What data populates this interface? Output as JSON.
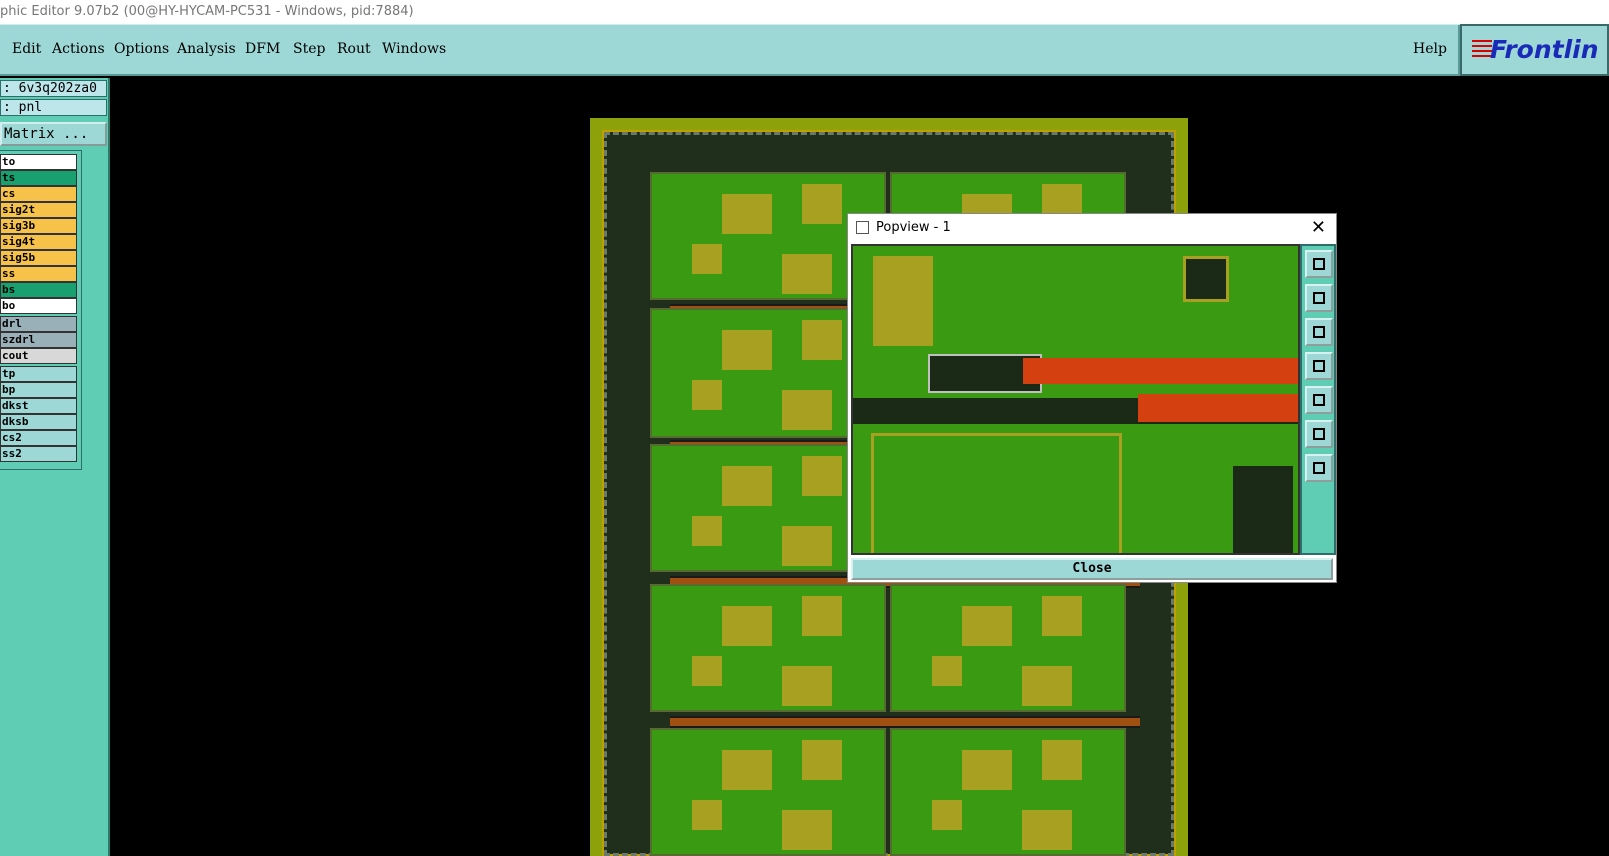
{
  "window": {
    "title": "phic Editor 9.07b2 (00@HY-HYCAM-PC531 - Windows, pid:7884)"
  },
  "menu": {
    "items": [
      {
        "label": "Edit"
      },
      {
        "label": "Actions"
      },
      {
        "label": "Options"
      },
      {
        "label": "Analysis"
      },
      {
        "label": "DFM"
      },
      {
        "label": "Step"
      },
      {
        "label": "Rout"
      },
      {
        "label": "Windows"
      }
    ],
    "help": "Help"
  },
  "logo": {
    "text": "Frontlin"
  },
  "left_panel": {
    "job_field": ": 6v3q202za0",
    "step_field": ": pnl",
    "matrix_button": "Matrix ...",
    "layers": [
      {
        "label": "to",
        "color": "#ffffff"
      },
      {
        "label": "ts",
        "color": "#18a070"
      },
      {
        "label": "cs",
        "color": "#f7c24a"
      },
      {
        "label": "sig2t",
        "color": "#f7c24a"
      },
      {
        "label": "sig3b",
        "color": "#f7c24a"
      },
      {
        "label": "sig4t",
        "color": "#f7c24a"
      },
      {
        "label": "sig5b",
        "color": "#f7c24a"
      },
      {
        "label": "ss",
        "color": "#f7c24a"
      },
      {
        "label": "bs",
        "color": "#18a070"
      },
      {
        "label": "bo",
        "color": "#ffffff"
      },
      {
        "label": "drl",
        "color": "#9ab0b8"
      },
      {
        "label": "szdrl",
        "color": "#9ab0b8"
      },
      {
        "label": "cout",
        "color": "#d8d8d8"
      },
      {
        "label": "tp",
        "color": "#9dd8d6"
      },
      {
        "label": "bp",
        "color": "#9dd8d6"
      },
      {
        "label": "dkst",
        "color": "#9dd8d6"
      },
      {
        "label": "dksb",
        "color": "#9dd8d6"
      },
      {
        "label": "cs2",
        "color": "#9dd8d6"
      },
      {
        "label": "ss2",
        "color": "#9dd8d6"
      }
    ]
  },
  "popview": {
    "title": "Popview - 1",
    "close_label": "Close",
    "tools": [
      "zoom-window-icon",
      "pan-up-icon",
      "pan-down-icon",
      "pan-left-icon",
      "pan-right-icon",
      "zoom-in-icon",
      "zoom-fit-icon"
    ]
  }
}
